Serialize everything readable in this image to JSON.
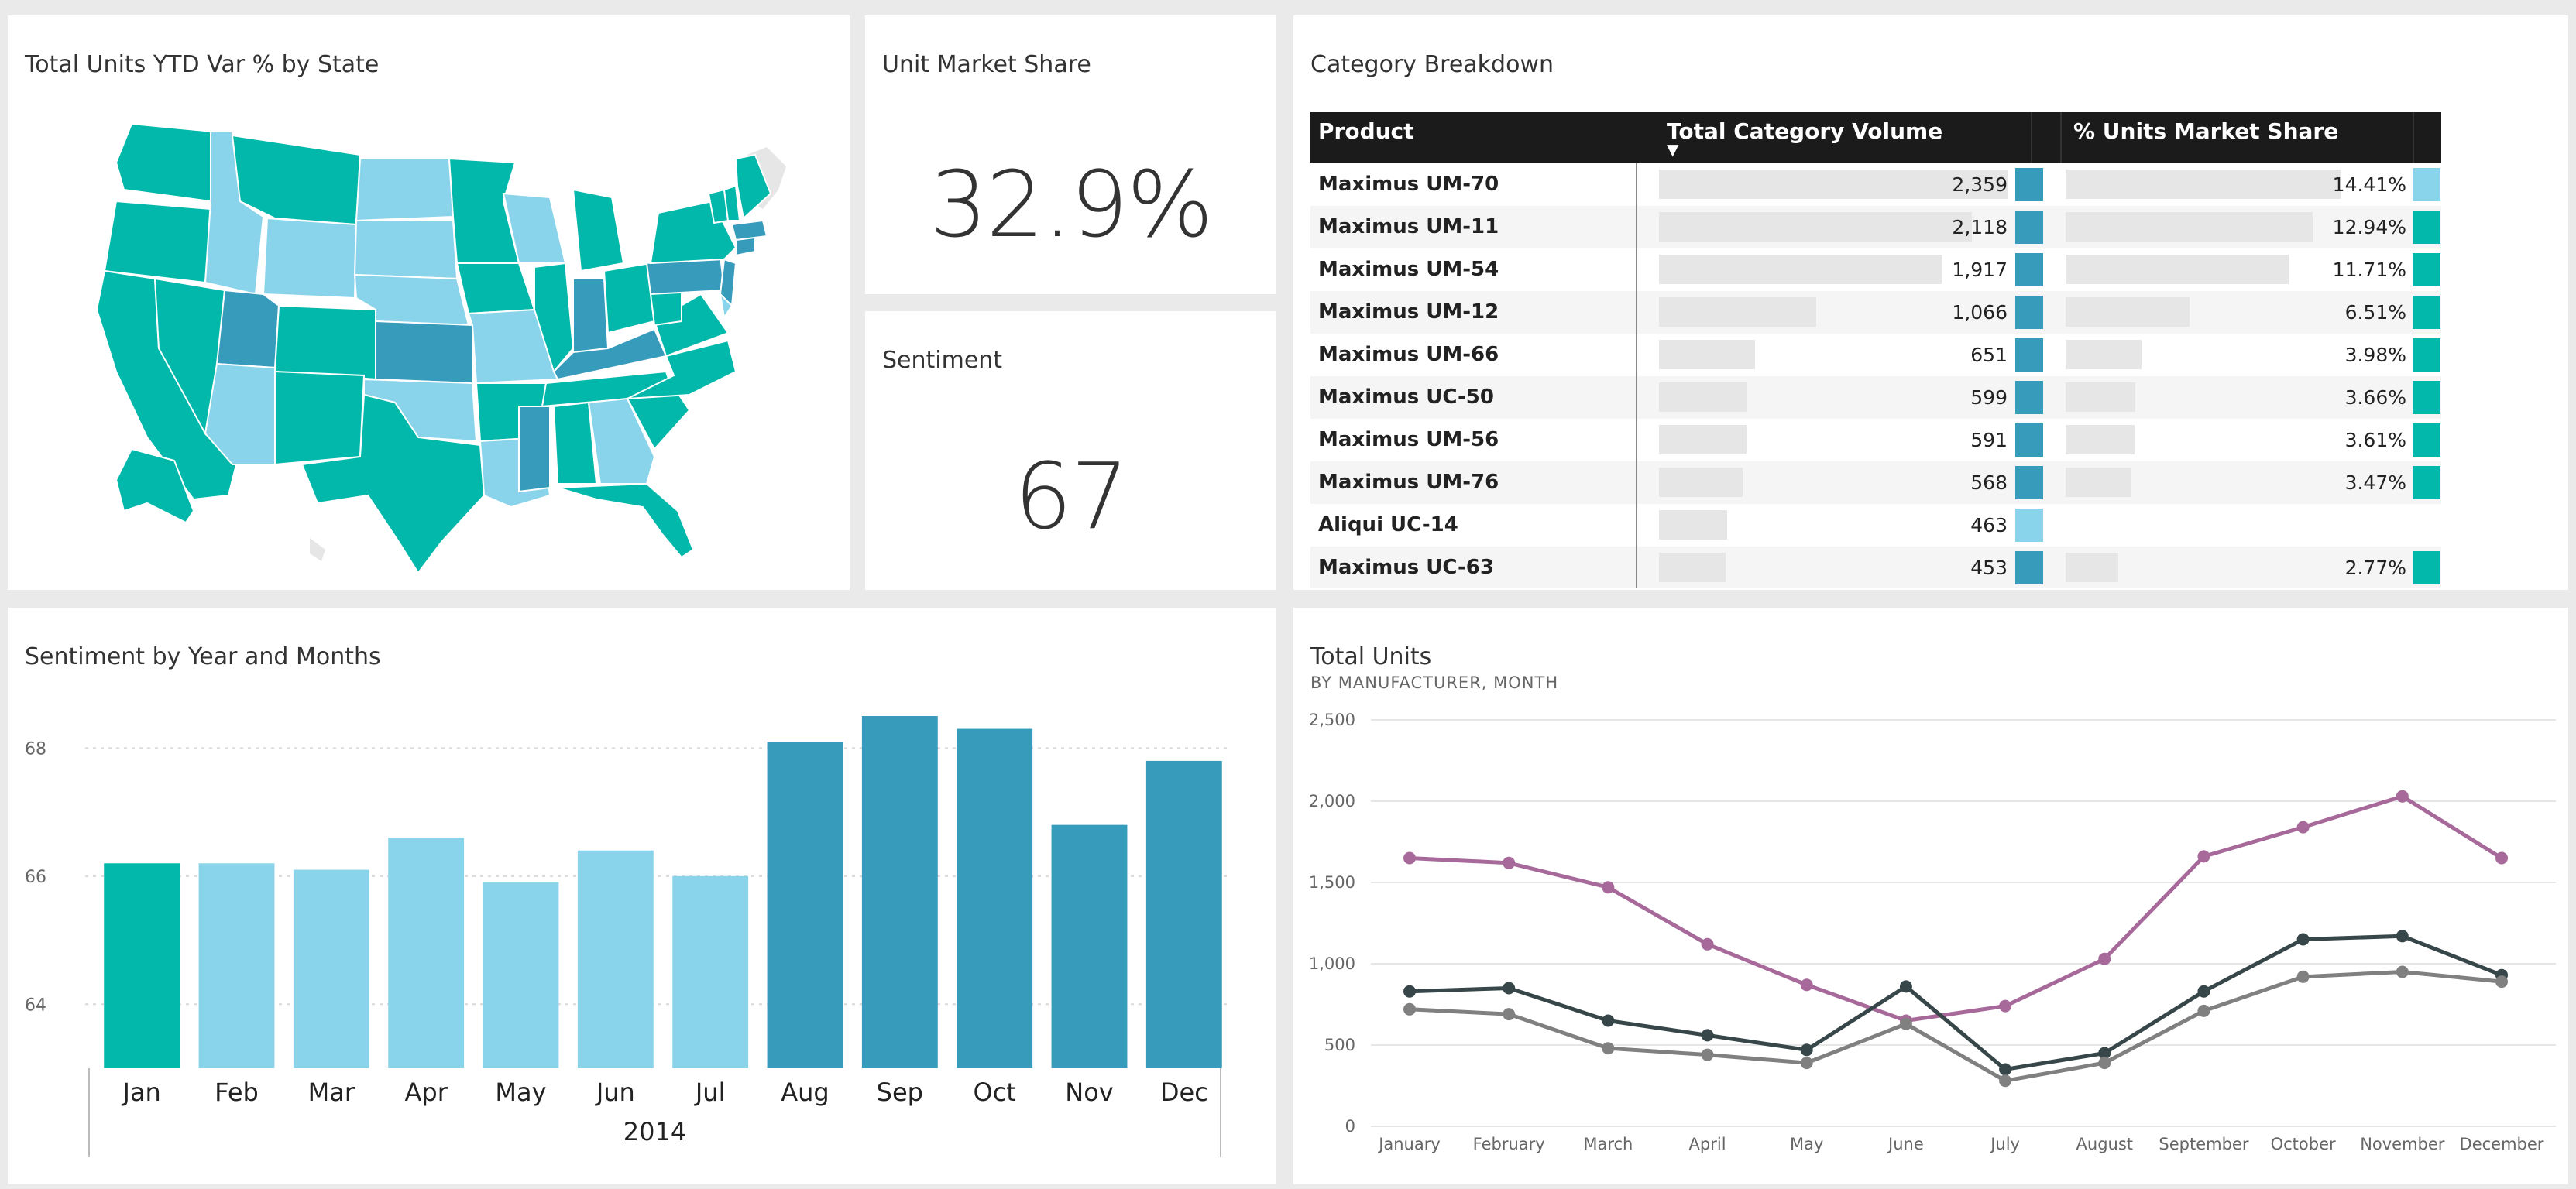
{
  "colors": {
    "teal": "#01b8aa",
    "light_blue": "#8ad4eb",
    "dark_blue": "#379bbc",
    "purple": "#a66999",
    "dark_gray": "#374649",
    "gray": "#808080"
  },
  "map_tile": {
    "title": "Total Units YTD Var % by State",
    "states": {
      "teal": [
        "WA",
        "OR",
        "CA",
        "NV",
        "MT",
        "CO",
        "AZ-none",
        "NM",
        "TX",
        "MN",
        "IA",
        "IL",
        "WI-none",
        "MI",
        "OH",
        "VA",
        "NC",
        "SC",
        "FL",
        "AL",
        "AR",
        "MS-none",
        "NY",
        "ME",
        "VT",
        "NH",
        "AK",
        "WV",
        "TN",
        "LA-none",
        "ND-none",
        "NE-none",
        "KS-none",
        "OK-none"
      ],
      "light_blue": [
        "ID",
        "WY",
        "ND",
        "SD",
        "NE",
        "MO",
        "WI",
        "AZ",
        "OK",
        "LA",
        "GA",
        "IN-none",
        "DE"
      ],
      "dark_blue": [
        "UT",
        "KS",
        "MS",
        "IN",
        "KY",
        "PA",
        "NJ",
        "MA",
        "CT",
        "RI"
      ],
      "gray": [
        "HI",
        "PR",
        "Canada"
      ]
    }
  },
  "kpi_share": {
    "title": "Unit Market Share",
    "value": "32.9%"
  },
  "kpi_sentiment": {
    "title": "Sentiment",
    "value": "67"
  },
  "table": {
    "title": "Category Breakdown",
    "headers": [
      "Product",
      "Total Category Volume",
      "% Units Market Share"
    ],
    "rows": [
      {
        "product": "Maximus UM-70",
        "volume": 2359,
        "volume_label": "2,359",
        "share": 14.41,
        "share_label": "14.41%",
        "vol_color": "#379bbc",
        "share_color": "#8ad4eb"
      },
      {
        "product": "Maximus UM-11",
        "volume": 2118,
        "volume_label": "2,118",
        "share": 12.94,
        "share_label": "12.94%",
        "vol_color": "#379bbc",
        "share_color": "#01b8aa"
      },
      {
        "product": "Maximus UM-54",
        "volume": 1917,
        "volume_label": "1,917",
        "share": 11.71,
        "share_label": "11.71%",
        "vol_color": "#379bbc",
        "share_color": "#01b8aa"
      },
      {
        "product": "Maximus UM-12",
        "volume": 1066,
        "volume_label": "1,066",
        "share": 6.51,
        "share_label": "6.51%",
        "vol_color": "#379bbc",
        "share_color": "#01b8aa"
      },
      {
        "product": "Maximus UM-66",
        "volume": 651,
        "volume_label": "651",
        "share": 3.98,
        "share_label": "3.98%",
        "vol_color": "#379bbc",
        "share_color": "#01b8aa"
      },
      {
        "product": "Maximus UC-50",
        "volume": 599,
        "volume_label": "599",
        "share": 3.66,
        "share_label": "3.66%",
        "vol_color": "#379bbc",
        "share_color": "#01b8aa"
      },
      {
        "product": "Maximus UM-56",
        "volume": 591,
        "volume_label": "591",
        "share": 3.61,
        "share_label": "3.61%",
        "vol_color": "#379bbc",
        "share_color": "#01b8aa"
      },
      {
        "product": "Maximus UM-76",
        "volume": 568,
        "volume_label": "568",
        "share": 3.47,
        "share_label": "3.47%",
        "vol_color": "#379bbc",
        "share_color": "#01b8aa"
      },
      {
        "product": "Aliqui UC-14",
        "volume": 463,
        "volume_label": "463",
        "share": null,
        "share_label": "",
        "vol_color": "#8ad4eb",
        "share_color": ""
      },
      {
        "product": "Maximus UC-63",
        "volume": 453,
        "volume_label": "453",
        "share": 2.77,
        "share_label": "2.77%",
        "vol_color": "#379bbc",
        "share_color": "#01b8aa"
      }
    ]
  },
  "chart_data": [
    {
      "type": "bar",
      "title": "Sentiment by Year and Months",
      "categories": [
        "Jan",
        "Feb",
        "Mar",
        "Apr",
        "May",
        "Jun",
        "Jul",
        "Aug",
        "Sep",
        "Oct",
        "Nov",
        "Dec"
      ],
      "values": [
        66.2,
        66.2,
        66.1,
        66.6,
        65.9,
        66.4,
        66.0,
        68.1,
        68.5,
        68.3,
        66.8,
        67.8
      ],
      "bar_colors": [
        "#01b8aa",
        "#8ad4eb",
        "#8ad4eb",
        "#8ad4eb",
        "#8ad4eb",
        "#8ad4eb",
        "#8ad4eb",
        "#379bbc",
        "#379bbc",
        "#379bbc",
        "#379bbc",
        "#379bbc"
      ],
      "year_label": "2014",
      "yticks": [
        64,
        66,
        68
      ],
      "ylim": [
        63,
        68.5
      ],
      "grid": true
    },
    {
      "type": "line",
      "title": "Total Units",
      "subtitle": "BY MANUFACTURER, MONTH",
      "x": [
        "January",
        "February",
        "March",
        "April",
        "May",
        "June",
        "July",
        "August",
        "September",
        "October",
        "November",
        "December"
      ],
      "ylim": [
        0,
        2500
      ],
      "yticks": [
        0,
        500,
        1000,
        1500,
        2000,
        2500
      ],
      "ytick_labels": [
        "0",
        "500",
        "1,000",
        "1,500",
        "2,000",
        "2,500"
      ],
      "series": [
        {
          "color": "#a66999",
          "values": [
            1650,
            1620,
            1470,
            1120,
            870,
            650,
            740,
            1030,
            1660,
            1840,
            2030,
            1650
          ]
        },
        {
          "color": "#374649",
          "values": [
            830,
            850,
            650,
            560,
            470,
            860,
            350,
            450,
            830,
            1150,
            1170,
            930
          ]
        },
        {
          "color": "#808080",
          "values": [
            720,
            690,
            480,
            440,
            390,
            630,
            280,
            390,
            710,
            920,
            950,
            890
          ]
        }
      ],
      "grid": true
    }
  ]
}
